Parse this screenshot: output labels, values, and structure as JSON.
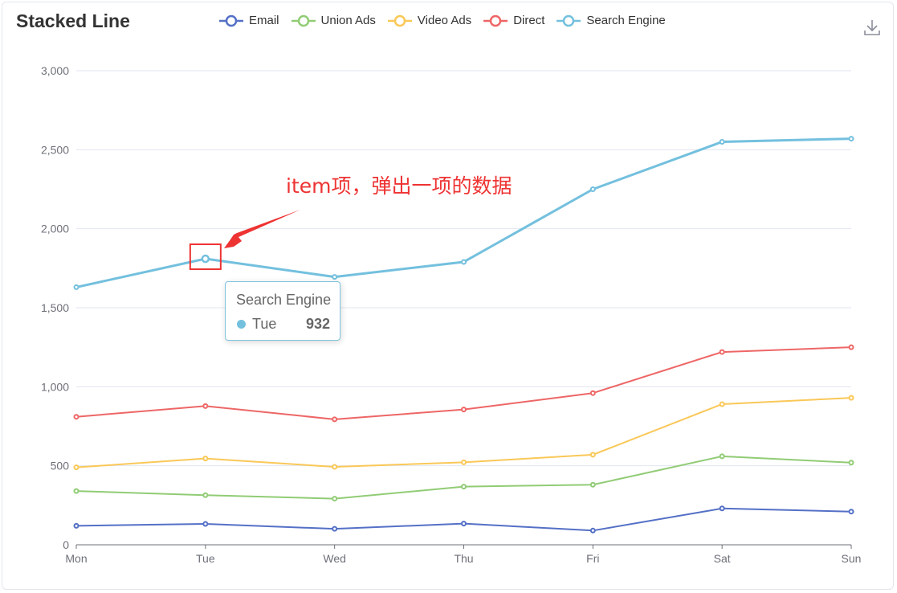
{
  "colors": {
    "email": "#5470c6",
    "union": "#91cc75",
    "video": "#fac858",
    "direct": "#ee6666",
    "search": "#73c0de",
    "annotation": "#ee3333"
  },
  "download_icon": "download-icon",
  "annotation_text": "item项，弹出一项的数据",
  "tooltip": {
    "series": "Search Engine",
    "category": "Tue",
    "value": "932",
    "color": "#73c0de"
  },
  "chart_data": {
    "type": "line",
    "title": "Stacked Line",
    "stacked": true,
    "categories": [
      "Mon",
      "Tue",
      "Wed",
      "Thu",
      "Fri",
      "Sat",
      "Sun"
    ],
    "ylim": [
      0,
      3000
    ],
    "y_ticks": [
      0,
      500,
      1000,
      1500,
      2000,
      2500,
      3000
    ],
    "y_tick_labels": [
      "0",
      "500",
      "1,000",
      "1,500",
      "2,000",
      "2,500",
      "3,000"
    ],
    "grid": true,
    "legend_position": "top",
    "series": [
      {
        "name": "Email",
        "key": "email",
        "values": [
          120,
          132,
          101,
          134,
          90,
          230,
          210
        ],
        "stacked_values": [
          120,
          132,
          101,
          134,
          90,
          230,
          210
        ]
      },
      {
        "name": "Union Ads",
        "key": "union",
        "values": [
          220,
          182,
          191,
          234,
          290,
          330,
          310
        ],
        "stacked_values": [
          340,
          314,
          292,
          368,
          380,
          560,
          520
        ]
      },
      {
        "name": "Video Ads",
        "key": "video",
        "values": [
          150,
          232,
          201,
          154,
          190,
          330,
          410
        ],
        "stacked_values": [
          490,
          546,
          493,
          522,
          570,
          890,
          930
        ]
      },
      {
        "name": "Direct",
        "key": "direct",
        "values": [
          320,
          332,
          301,
          334,
          390,
          330,
          320
        ],
        "stacked_values": [
          810,
          878,
          794,
          856,
          960,
          1220,
          1250
        ]
      },
      {
        "name": "Search Engine",
        "key": "search",
        "values": [
          820,
          932,
          901,
          934,
          1290,
          1330,
          1320
        ],
        "stacked_values": [
          1630,
          1810,
          1695,
          1790,
          2250,
          2550,
          2570
        ]
      }
    ]
  }
}
